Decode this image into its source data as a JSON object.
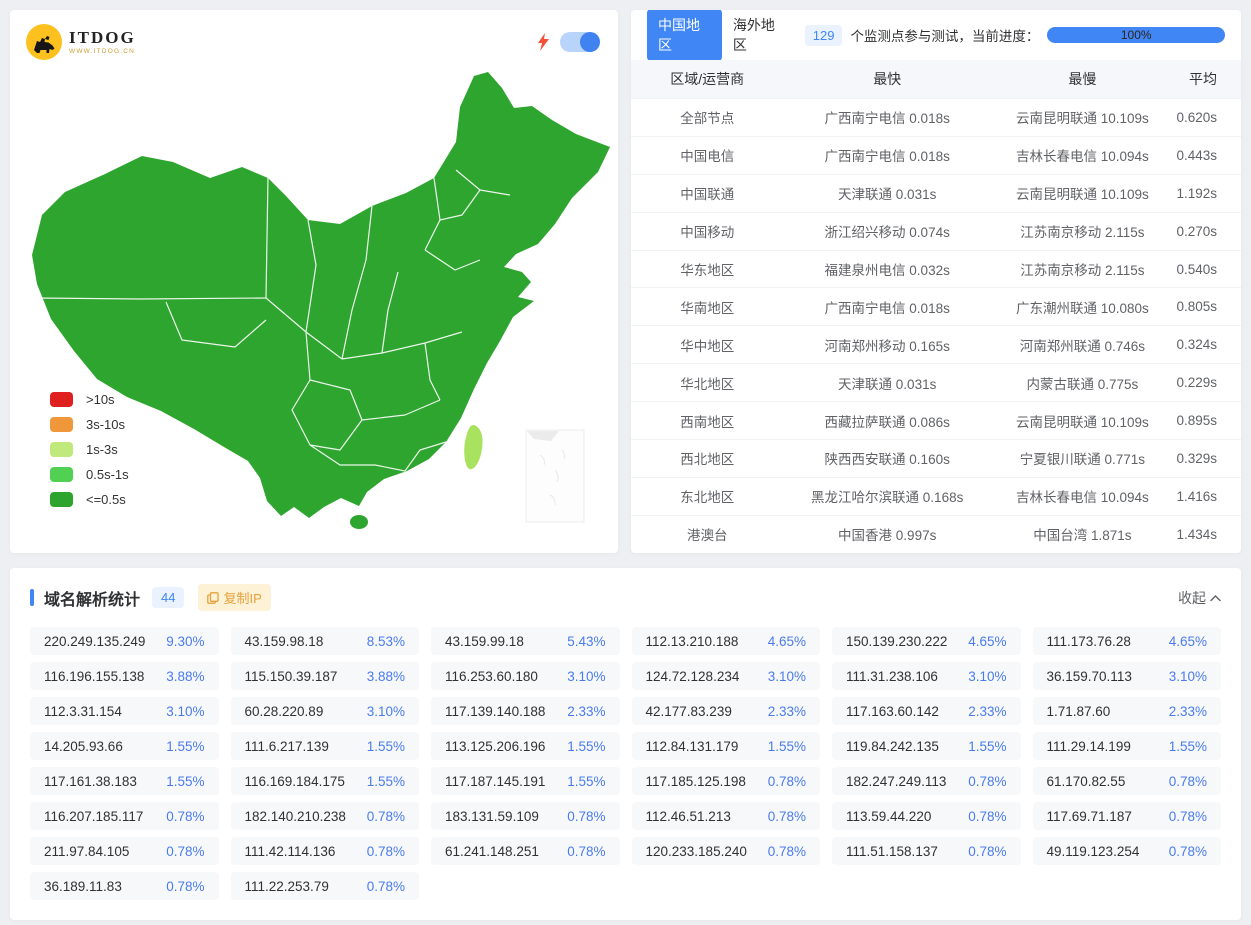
{
  "colors": {
    "accent": "#4086f4",
    "percent_blue": "#4a7bee",
    "map_green": "#2ea52f",
    "taiwan_green": "#a9e25f",
    "logo_yellow": "#fcc11e"
  },
  "logo": {
    "title": "ITDOG",
    "subtitle": "WWW.ITDOG.CN"
  },
  "map": {
    "legend": [
      {
        "label": ">10s",
        "color": "#e0201f"
      },
      {
        "label": "3s-10s",
        "color": "#f0973b"
      },
      {
        "label": "1s-3s",
        "color": "#bfe97a"
      },
      {
        "label": "0.5s-1s",
        "color": "#52d053"
      },
      {
        "label": "<=0.5s",
        "color": "#2da42d"
      }
    ]
  },
  "results": {
    "tabs": [
      {
        "label": "中国地区"
      },
      {
        "label": "海外地区"
      }
    ],
    "monitor_count": "129",
    "monitor_text": "个监测点参与测试，当前进度：",
    "progress_label": "100%",
    "headers": {
      "region": "区域/运营商",
      "fastest": "最快",
      "slowest": "最慢",
      "avg": "平均"
    },
    "rows": [
      {
        "region": "全部节点",
        "fastest": "广西南宁电信 0.018s",
        "slowest": "云南昆明联通 10.109s",
        "avg": "0.620s"
      },
      {
        "region": "中国电信",
        "fastest": "广西南宁电信 0.018s",
        "slowest": "吉林长春电信 10.094s",
        "avg": "0.443s"
      },
      {
        "region": "中国联通",
        "fastest": "天津联通 0.031s",
        "slowest": "云南昆明联通 10.109s",
        "avg": "1.192s"
      },
      {
        "region": "中国移动",
        "fastest": "浙江绍兴移动 0.074s",
        "slowest": "江苏南京移动 2.115s",
        "avg": "0.270s"
      },
      {
        "region": "华东地区",
        "fastest": "福建泉州电信 0.032s",
        "slowest": "江苏南京移动 2.115s",
        "avg": "0.540s"
      },
      {
        "region": "华南地区",
        "fastest": "广西南宁电信 0.018s",
        "slowest": "广东潮州联通 10.080s",
        "avg": "0.805s"
      },
      {
        "region": "华中地区",
        "fastest": "河南郑州移动 0.165s",
        "slowest": "河南郑州联通 0.746s",
        "avg": "0.324s"
      },
      {
        "region": "华北地区",
        "fastest": "天津联通 0.031s",
        "slowest": "内蒙古联通 0.775s",
        "avg": "0.229s"
      },
      {
        "region": "西南地区",
        "fastest": "西藏拉萨联通 0.086s",
        "slowest": "云南昆明联通 10.109s",
        "avg": "0.895s"
      },
      {
        "region": "西北地区",
        "fastest": "陕西西安联通 0.160s",
        "slowest": "宁夏银川联通 0.771s",
        "avg": "0.329s"
      },
      {
        "region": "东北地区",
        "fastest": "黑龙江哈尔滨联通 0.168s",
        "slowest": "吉林长春电信 10.094s",
        "avg": "1.416s"
      },
      {
        "region": "港澳台",
        "fastest": "中国香港 0.997s",
        "slowest": "中国台湾 1.871s",
        "avg": "1.434s"
      }
    ]
  },
  "dns": {
    "title": "域名解析统计",
    "count": "44",
    "copy_label": "复制IP",
    "collapse_label": "收起",
    "items": [
      {
        "ip": "220.249.135.249",
        "pct": "9.30%"
      },
      {
        "ip": "43.159.98.18",
        "pct": "8.53%"
      },
      {
        "ip": "43.159.99.18",
        "pct": "5.43%"
      },
      {
        "ip": "112.13.210.188",
        "pct": "4.65%"
      },
      {
        "ip": "150.139.230.222",
        "pct": "4.65%"
      },
      {
        "ip": "111.173.76.28",
        "pct": "4.65%"
      },
      {
        "ip": "116.196.155.138",
        "pct": "3.88%"
      },
      {
        "ip": "115.150.39.187",
        "pct": "3.88%"
      },
      {
        "ip": "116.253.60.180",
        "pct": "3.10%"
      },
      {
        "ip": "124.72.128.234",
        "pct": "3.10%"
      },
      {
        "ip": "111.31.238.106",
        "pct": "3.10%"
      },
      {
        "ip": "36.159.70.113",
        "pct": "3.10%"
      },
      {
        "ip": "112.3.31.154",
        "pct": "3.10%"
      },
      {
        "ip": "60.28.220.89",
        "pct": "3.10%"
      },
      {
        "ip": "117.139.140.188",
        "pct": "2.33%"
      },
      {
        "ip": "42.177.83.239",
        "pct": "2.33%"
      },
      {
        "ip": "117.163.60.142",
        "pct": "2.33%"
      },
      {
        "ip": "1.71.87.60",
        "pct": "2.33%"
      },
      {
        "ip": "14.205.93.66",
        "pct": "1.55%"
      },
      {
        "ip": "111.6.217.139",
        "pct": "1.55%"
      },
      {
        "ip": "113.125.206.196",
        "pct": "1.55%"
      },
      {
        "ip": "112.84.131.179",
        "pct": "1.55%"
      },
      {
        "ip": "119.84.242.135",
        "pct": "1.55%"
      },
      {
        "ip": "111.29.14.199",
        "pct": "1.55%"
      },
      {
        "ip": "117.161.38.183",
        "pct": "1.55%"
      },
      {
        "ip": "116.169.184.175",
        "pct": "1.55%"
      },
      {
        "ip": "117.187.145.191",
        "pct": "1.55%"
      },
      {
        "ip": "117.185.125.198",
        "pct": "0.78%"
      },
      {
        "ip": "182.247.249.113",
        "pct": "0.78%"
      },
      {
        "ip": "61.170.82.55",
        "pct": "0.78%"
      },
      {
        "ip": "116.207.185.117",
        "pct": "0.78%"
      },
      {
        "ip": "182.140.210.238",
        "pct": "0.78%"
      },
      {
        "ip": "183.131.59.109",
        "pct": "0.78%"
      },
      {
        "ip": "112.46.51.213",
        "pct": "0.78%"
      },
      {
        "ip": "113.59.44.220",
        "pct": "0.78%"
      },
      {
        "ip": "117.69.71.187",
        "pct": "0.78%"
      },
      {
        "ip": "211.97.84.105",
        "pct": "0.78%"
      },
      {
        "ip": "111.42.114.136",
        "pct": "0.78%"
      },
      {
        "ip": "61.241.148.251",
        "pct": "0.78%"
      },
      {
        "ip": "120.233.185.240",
        "pct": "0.78%"
      },
      {
        "ip": "111.51.158.137",
        "pct": "0.78%"
      },
      {
        "ip": "49.119.123.254",
        "pct": "0.78%"
      },
      {
        "ip": "36.189.11.83",
        "pct": "0.78%"
      },
      {
        "ip": "111.22.253.79",
        "pct": "0.78%"
      }
    ]
  }
}
